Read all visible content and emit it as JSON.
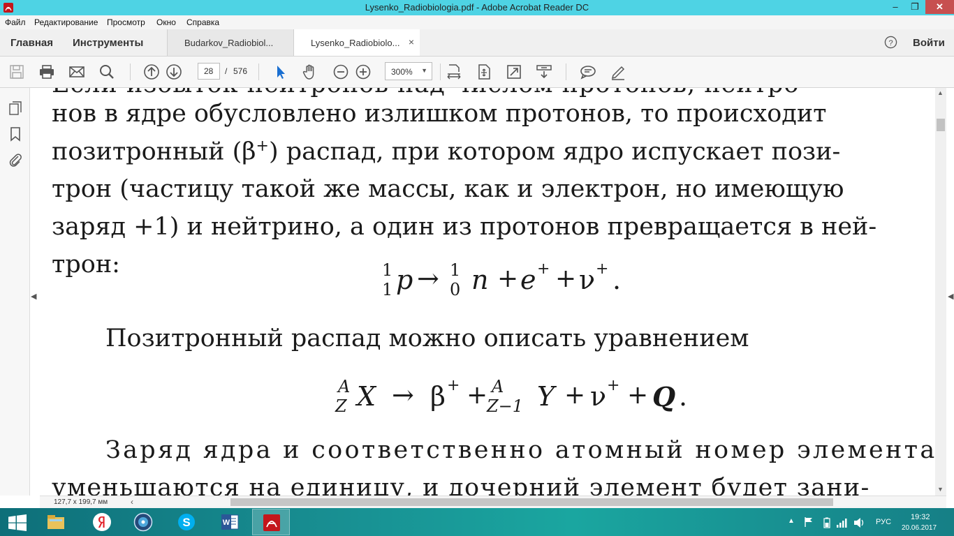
{
  "window": {
    "title": "Lysenko_Radiobiologia.pdf - Adobe Acrobat Reader DC",
    "minimize": "–",
    "maximize": "❐",
    "close": "✕"
  },
  "menu": [
    "Файл",
    "Редактирование",
    "Просмотр",
    "Окно",
    "Справка"
  ],
  "tabs": {
    "home": "Главная",
    "tools": "Инструменты",
    "docs": [
      {
        "label": "Budarkov_Radiobiol...",
        "active": false
      },
      {
        "label": "Lysenko_Radiobiolo...",
        "active": true,
        "close": "×"
      }
    ],
    "signin": "Войти"
  },
  "toolbar": {
    "current_page": "28",
    "page_sep": "/",
    "total_pages": "576",
    "zoom": "300%",
    "icons": [
      "save-icon",
      "print-icon",
      "email-icon",
      "search-icon",
      "page-up-icon",
      "page-down-icon",
      "select-cursor-icon",
      "hand-icon",
      "zoom-out-icon",
      "zoom-in-icon",
      "fit-width-icon",
      "fit-page-icon",
      "fullscreen-icon",
      "read-mode-icon",
      "comment-icon",
      "sign-icon"
    ]
  },
  "document": {
    "lines": [
      "нов в ядре обусловлено излишком протонов, то происходит",
      "позитронный (β",
      "трон (частицу такой же массы, как и электрон, но имеющую",
      "заряд +1) и нейтрино, а один из протонов превращается в ней-",
      "трон:"
    ],
    "line2_sup": "+",
    "line2_rest": ") распад, при котором ядро испускает пози-",
    "formula1": {
      "a_top": "1",
      "a_bot": "1",
      "p": "p",
      "arrow": "→",
      "b_top": "1",
      "b_bot": "0",
      "rest_n": "n",
      "plus": "+",
      "e": "e",
      "e_sup": "+",
      "nu": "ν",
      "nu_sup": "+",
      "end": "."
    },
    "para2": "Позитронный распад можно описать уравнением",
    "formula2": {
      "a_top": "A",
      "a_bot": "Z",
      "X": "X",
      "arrow": "→",
      "beta": "β",
      "beta_sup": "+",
      "plus": "+",
      "b_top": "A",
      "b_bot": "Z−1",
      "Y": "Y",
      "nu": "ν",
      "nu_sup": "+",
      "Q": "Q",
      "end": "."
    },
    "para3": "Заряд ядра и соответственно атомный номер элемента",
    "para4": "уменьшаются на единицу, и дочерний элемент будет зани-"
  },
  "status": {
    "page_size": "127,7 x 199,7 мм"
  },
  "taskbar": {
    "apps": [
      "file-explorer-icon",
      "yandex-browser-icon",
      "media-app-icon",
      "skype-icon",
      "word-icon",
      "acrobat-icon"
    ],
    "lang": "РУС",
    "time": "19:32",
    "date": "20.06.2017"
  },
  "colors": {
    "titlebar": "#4ed3e4",
    "close": "#c75050",
    "acrobat_red": "#c4161c"
  }
}
